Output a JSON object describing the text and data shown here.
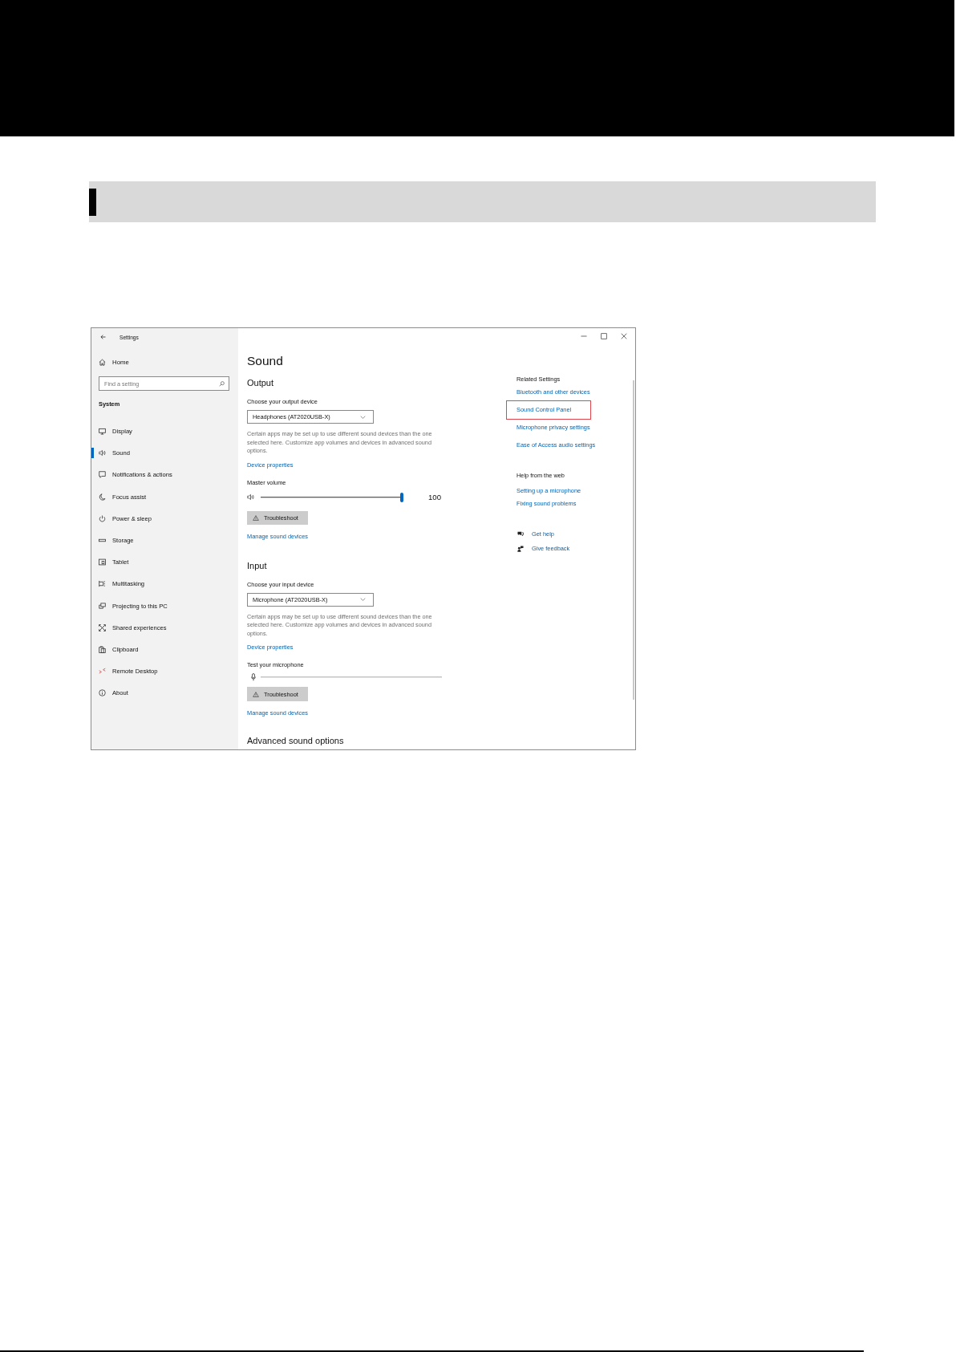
{
  "window": {
    "title": "Settings"
  },
  "sidebar": {
    "home": "Home",
    "search": {
      "placeholder": "Find a setting"
    },
    "section": "System",
    "items": [
      {
        "label": "Display",
        "selected": false
      },
      {
        "label": "Sound",
        "selected": true
      },
      {
        "label": "Notifications & actions",
        "selected": false
      },
      {
        "label": "Focus assist",
        "selected": false
      },
      {
        "label": "Power & sleep",
        "selected": false
      },
      {
        "label": "Storage",
        "selected": false
      },
      {
        "label": "Tablet",
        "selected": false
      },
      {
        "label": "Multitasking",
        "selected": false
      },
      {
        "label": "Projecting to this PC",
        "selected": false
      },
      {
        "label": "Shared experiences",
        "selected": false
      },
      {
        "label": "Clipboard",
        "selected": false
      },
      {
        "label": "Remote Desktop",
        "selected": false
      },
      {
        "label": "About",
        "selected": false
      }
    ]
  },
  "main": {
    "title": "Sound",
    "sections": [
      {
        "heading": "Output",
        "device_label": "Choose your output device",
        "device": "Headphones (AT2020USB-X)",
        "note": "Certain apps may be set up to use different sound devices than the one selected here. Customize app volumes and devices in advanced sound options.",
        "properties_link": "Device properties",
        "meter": {
          "kind": "slider",
          "label": "Master volume",
          "level": 1,
          "reading": "100"
        },
        "button": "Troubleshoot",
        "manage_link": "Manage sound devices"
      },
      {
        "heading": "Input",
        "device_label": "Choose your input device",
        "device": "Microphone (AT2020USB-X)",
        "note": "Certain apps may be set up to use different sound devices than the one selected here. Customize app volumes and devices in advanced sound options.",
        "properties_link": "Device properties",
        "meter": {
          "kind": "meter",
          "label": "Test your microphone"
        },
        "button": "Troubleshoot",
        "manage_link": "Manage sound devices"
      }
    ],
    "next_heading": "Advanced sound options"
  },
  "related": {
    "heading": "Related Settings",
    "links": [
      {
        "label": "Bluetooth and other devices",
        "highlighted": false
      },
      {
        "label": "Sound Control Panel",
        "highlighted": true
      },
      {
        "label": "Microphone privacy settings",
        "highlighted": false
      },
      {
        "label": "Ease of Access audio settings",
        "highlighted": false
      }
    ]
  },
  "help": {
    "heading": "Help from the web",
    "links": [
      "Setting up a microphone",
      "Fixing sound problems"
    ]
  },
  "support": [
    "Get help",
    "Give feedback"
  ]
}
